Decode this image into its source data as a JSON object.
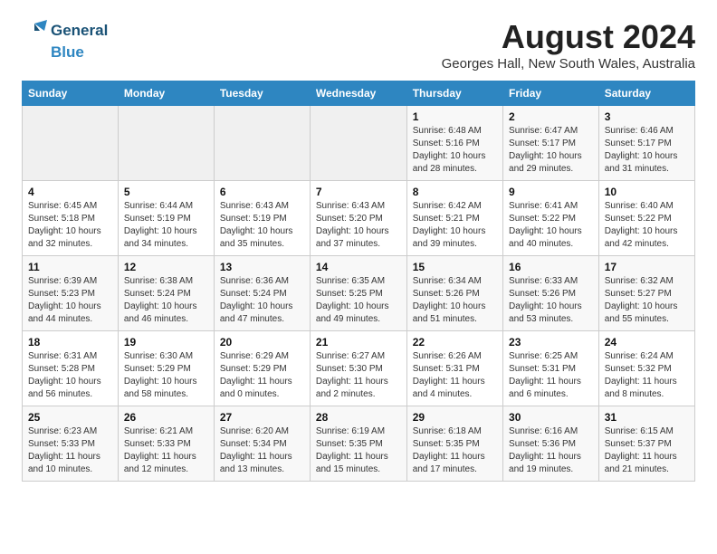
{
  "logo": {
    "line1": "General",
    "line2": "Blue"
  },
  "title": "August 2024",
  "location": "Georges Hall, New South Wales, Australia",
  "days_of_week": [
    "Sunday",
    "Monday",
    "Tuesday",
    "Wednesday",
    "Thursday",
    "Friday",
    "Saturday"
  ],
  "weeks": [
    [
      {
        "day": "",
        "info": ""
      },
      {
        "day": "",
        "info": ""
      },
      {
        "day": "",
        "info": ""
      },
      {
        "day": "",
        "info": ""
      },
      {
        "day": "1",
        "info": "Sunrise: 6:48 AM\nSunset: 5:16 PM\nDaylight: 10 hours\nand 28 minutes."
      },
      {
        "day": "2",
        "info": "Sunrise: 6:47 AM\nSunset: 5:17 PM\nDaylight: 10 hours\nand 29 minutes."
      },
      {
        "day": "3",
        "info": "Sunrise: 6:46 AM\nSunset: 5:17 PM\nDaylight: 10 hours\nand 31 minutes."
      }
    ],
    [
      {
        "day": "4",
        "info": "Sunrise: 6:45 AM\nSunset: 5:18 PM\nDaylight: 10 hours\nand 32 minutes."
      },
      {
        "day": "5",
        "info": "Sunrise: 6:44 AM\nSunset: 5:19 PM\nDaylight: 10 hours\nand 34 minutes."
      },
      {
        "day": "6",
        "info": "Sunrise: 6:43 AM\nSunset: 5:19 PM\nDaylight: 10 hours\nand 35 minutes."
      },
      {
        "day": "7",
        "info": "Sunrise: 6:43 AM\nSunset: 5:20 PM\nDaylight: 10 hours\nand 37 minutes."
      },
      {
        "day": "8",
        "info": "Sunrise: 6:42 AM\nSunset: 5:21 PM\nDaylight: 10 hours\nand 39 minutes."
      },
      {
        "day": "9",
        "info": "Sunrise: 6:41 AM\nSunset: 5:22 PM\nDaylight: 10 hours\nand 40 minutes."
      },
      {
        "day": "10",
        "info": "Sunrise: 6:40 AM\nSunset: 5:22 PM\nDaylight: 10 hours\nand 42 minutes."
      }
    ],
    [
      {
        "day": "11",
        "info": "Sunrise: 6:39 AM\nSunset: 5:23 PM\nDaylight: 10 hours\nand 44 minutes."
      },
      {
        "day": "12",
        "info": "Sunrise: 6:38 AM\nSunset: 5:24 PM\nDaylight: 10 hours\nand 46 minutes."
      },
      {
        "day": "13",
        "info": "Sunrise: 6:36 AM\nSunset: 5:24 PM\nDaylight: 10 hours\nand 47 minutes."
      },
      {
        "day": "14",
        "info": "Sunrise: 6:35 AM\nSunset: 5:25 PM\nDaylight: 10 hours\nand 49 minutes."
      },
      {
        "day": "15",
        "info": "Sunrise: 6:34 AM\nSunset: 5:26 PM\nDaylight: 10 hours\nand 51 minutes."
      },
      {
        "day": "16",
        "info": "Sunrise: 6:33 AM\nSunset: 5:26 PM\nDaylight: 10 hours\nand 53 minutes."
      },
      {
        "day": "17",
        "info": "Sunrise: 6:32 AM\nSunset: 5:27 PM\nDaylight: 10 hours\nand 55 minutes."
      }
    ],
    [
      {
        "day": "18",
        "info": "Sunrise: 6:31 AM\nSunset: 5:28 PM\nDaylight: 10 hours\nand 56 minutes."
      },
      {
        "day": "19",
        "info": "Sunrise: 6:30 AM\nSunset: 5:29 PM\nDaylight: 10 hours\nand 58 minutes."
      },
      {
        "day": "20",
        "info": "Sunrise: 6:29 AM\nSunset: 5:29 PM\nDaylight: 11 hours\nand 0 minutes."
      },
      {
        "day": "21",
        "info": "Sunrise: 6:27 AM\nSunset: 5:30 PM\nDaylight: 11 hours\nand 2 minutes."
      },
      {
        "day": "22",
        "info": "Sunrise: 6:26 AM\nSunset: 5:31 PM\nDaylight: 11 hours\nand 4 minutes."
      },
      {
        "day": "23",
        "info": "Sunrise: 6:25 AM\nSunset: 5:31 PM\nDaylight: 11 hours\nand 6 minutes."
      },
      {
        "day": "24",
        "info": "Sunrise: 6:24 AM\nSunset: 5:32 PM\nDaylight: 11 hours\nand 8 minutes."
      }
    ],
    [
      {
        "day": "25",
        "info": "Sunrise: 6:23 AM\nSunset: 5:33 PM\nDaylight: 11 hours\nand 10 minutes."
      },
      {
        "day": "26",
        "info": "Sunrise: 6:21 AM\nSunset: 5:33 PM\nDaylight: 11 hours\nand 12 minutes."
      },
      {
        "day": "27",
        "info": "Sunrise: 6:20 AM\nSunset: 5:34 PM\nDaylight: 11 hours\nand 13 minutes."
      },
      {
        "day": "28",
        "info": "Sunrise: 6:19 AM\nSunset: 5:35 PM\nDaylight: 11 hours\nand 15 minutes."
      },
      {
        "day": "29",
        "info": "Sunrise: 6:18 AM\nSunset: 5:35 PM\nDaylight: 11 hours\nand 17 minutes."
      },
      {
        "day": "30",
        "info": "Sunrise: 6:16 AM\nSunset: 5:36 PM\nDaylight: 11 hours\nand 19 minutes."
      },
      {
        "day": "31",
        "info": "Sunrise: 6:15 AM\nSunset: 5:37 PM\nDaylight: 11 hours\nand 21 minutes."
      }
    ]
  ]
}
